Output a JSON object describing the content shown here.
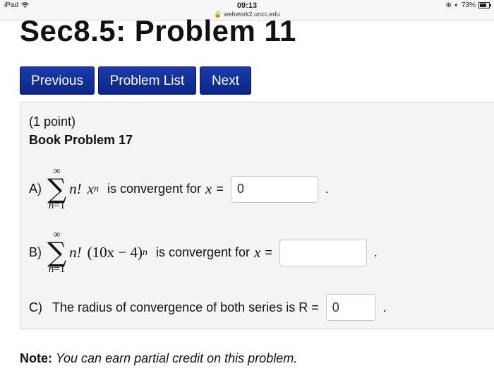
{
  "status_bar": {
    "device": "iPad",
    "time": "09:13",
    "url": "webwork2.uncc.edu",
    "battery": "73%",
    "battery_level": 0.73
  },
  "page": {
    "title": "Sec8.5: Problem 11"
  },
  "nav": {
    "previous": "Previous",
    "problem_list": "Problem List",
    "next": "Next"
  },
  "problem": {
    "points": "(1 point)",
    "book": "Book Problem 17",
    "parts": [
      {
        "label": "A)",
        "sum_upper": "∞",
        "sum_lower_var": "n",
        "sum_lower_eq": "=1",
        "expr_a": "n!",
        "expr_b": "x",
        "exponent": "n",
        "text": "is convergent for",
        "var": "x",
        "eq": "=",
        "value": "0",
        "end": "."
      },
      {
        "label": "B)",
        "sum_upper": "∞",
        "sum_lower_var": "n",
        "sum_lower_eq": "=1",
        "expr_a": "n!",
        "expr_b": "(10x − 4)",
        "exponent": "n",
        "text": "is convergent for",
        "var": "x",
        "eq": "=",
        "value": "",
        "end": "."
      },
      {
        "label": "C)",
        "text": "The radius of convergence of both series is R =",
        "value": "0",
        "end": "."
      }
    ]
  },
  "note": {
    "label": "Note:",
    "text": "You can earn partial credit on this problem."
  }
}
